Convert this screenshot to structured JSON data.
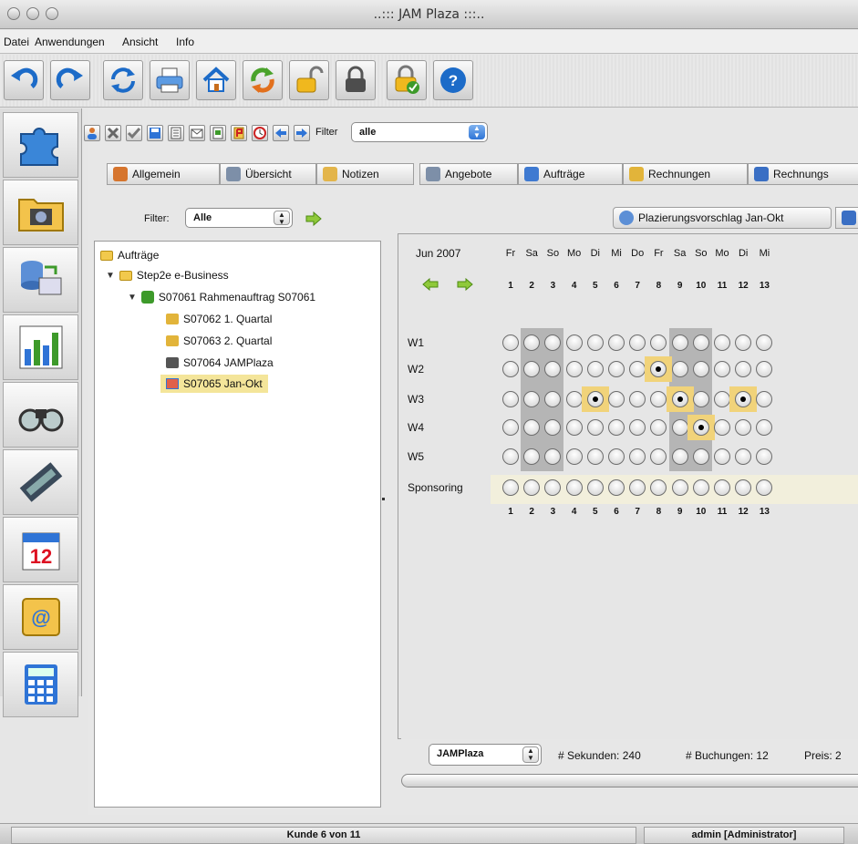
{
  "window": {
    "title": "..::: JAM Plaza :::.."
  },
  "menu": {
    "items": [
      "Datei",
      "Anwendungen",
      "Ansicht",
      "Info"
    ]
  },
  "toolbar": {
    "icons": [
      "undo-icon",
      "redo-icon",
      "refresh-icon",
      "print-icon",
      "home-icon",
      "sync-icon",
      "unlock-icon",
      "lock-icon",
      "lock-check-icon",
      "help-icon"
    ]
  },
  "sidebar": {
    "icons": [
      "puzzle-icon",
      "media-folder-icon",
      "database-network-icon",
      "chart-icon",
      "binoculars-icon",
      "film-icon",
      "calendar-icon",
      "address-book-icon",
      "calculator-icon"
    ]
  },
  "record_toolbar": {
    "icons": [
      "person-icon",
      "delete-icon",
      "check-icon",
      "save-icon",
      "document-icon",
      "mail-icon",
      "note-icon",
      "flag-icon",
      "clock-icon",
      "arrow-left-icon",
      "arrow-right-icon"
    ],
    "filter_label": "Filter",
    "filter_value": "alle"
  },
  "tabs": [
    {
      "label": "Allgemein",
      "color": "#d6752e"
    },
    {
      "label": "Übersicht",
      "color": "#7d8fa8"
    },
    {
      "label": "Notizen",
      "color": "#e3b54b"
    },
    {
      "label": "Angebote",
      "color": "#7d8fa8"
    },
    {
      "label": "Aufträge",
      "color": "#3f7ad1"
    },
    {
      "label": "Rechnungen",
      "color": "#e2b43a"
    },
    {
      "label": "Rechnungs",
      "color": "#3a6fc4"
    }
  ],
  "left_filter": {
    "label": "Filter:",
    "value": "Alle"
  },
  "tree": {
    "root": "Aufträge",
    "nodes": [
      {
        "label": "Step2e e-Business"
      },
      {
        "label": "S07061 Rahmenauftrag S07061"
      },
      {
        "label": "S07062 1. Quartal"
      },
      {
        "label": "S07063 2. Quartal"
      },
      {
        "label": "S07064 JAMPlaza"
      },
      {
        "label": "S07065 Jan-Okt"
      }
    ]
  },
  "calendar": {
    "tab_label": "Plazierungsvorschlag Jan-Okt",
    "month": "Jun 2007",
    "weekdays": [
      "Fr",
      "Sa",
      "So",
      "Mo",
      "Di",
      "Mi",
      "Do",
      "Fr",
      "Sa",
      "So",
      "Mo",
      "Di",
      "Mi"
    ],
    "days": [
      "1",
      "2",
      "3",
      "4",
      "5",
      "6",
      "7",
      "8",
      "9",
      "10",
      "11",
      "12",
      "13"
    ],
    "rows": [
      {
        "label": "W1",
        "selected": []
      },
      {
        "label": "W2",
        "selected": [
          8
        ]
      },
      {
        "label": "W3",
        "selected": [
          5,
          9,
          12
        ]
      },
      {
        "label": "W4",
        "selected": [
          10
        ]
      },
      {
        "label": "W5",
        "selected": []
      },
      {
        "label": "Sponsoring",
        "selected": []
      }
    ],
    "weekend_days": [
      2,
      3,
      9,
      10
    ]
  },
  "bottom": {
    "location_value": "JAMPlaza",
    "seconds": "# Sekunden: 240",
    "bookings": "# Buchungen: 12",
    "price": "Preis: 2"
  },
  "status": {
    "record": "Kunde 6 von 11",
    "user": "admin [Administrator]"
  }
}
